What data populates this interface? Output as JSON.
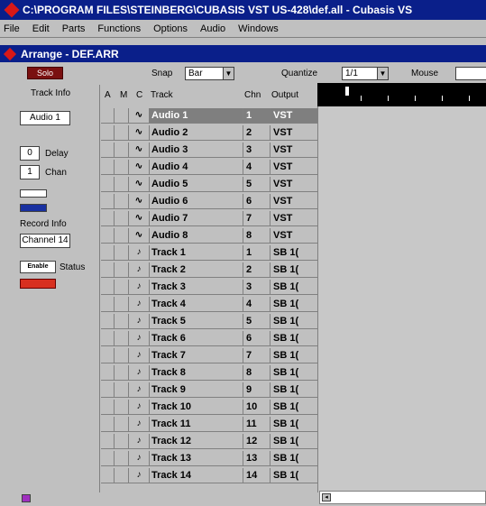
{
  "window": {
    "title": "C:\\PROGRAM FILES\\STEINBERG\\CUBASIS VST US-428\\def.all - Cubasis VS"
  },
  "menubar": {
    "items": [
      {
        "label": "File"
      },
      {
        "label": "Edit"
      },
      {
        "label": "Parts"
      },
      {
        "label": "Functions"
      },
      {
        "label": "Options"
      },
      {
        "label": "Audio"
      },
      {
        "label": "Windows"
      }
    ]
  },
  "arrange": {
    "title": "Arrange - DEF.ARR"
  },
  "toolbar": {
    "solo_label": "Solo",
    "snap_label": "Snap",
    "snap_value": "Bar",
    "quantize_label": "Quantize",
    "quantize_value": "1/1",
    "mouse_label": "Mouse"
  },
  "track_info": {
    "heading": "Track Info",
    "track_name": "Audio 1",
    "delay_value": "0",
    "delay_label": "Delay",
    "chan_value": "1",
    "chan_label": "Chan",
    "record_info_label": "Record Info",
    "record_channel": "Channel 14",
    "enable_label": "Enable",
    "status_label": "Status"
  },
  "track_table": {
    "headers": {
      "a": "A",
      "m": "M",
      "c": "C",
      "track": "Track",
      "chn": "Chn",
      "output": "Output"
    },
    "rows": [
      {
        "c": "∿",
        "track": "Audio 1",
        "chn": "1",
        "output": "VST",
        "selected": true
      },
      {
        "c": "∿",
        "track": "Audio 2",
        "chn": "2",
        "output": "VST"
      },
      {
        "c": "∿",
        "track": "Audio 3",
        "chn": "3",
        "output": "VST"
      },
      {
        "c": "∿",
        "track": "Audio 4",
        "chn": "4",
        "output": "VST"
      },
      {
        "c": "∿",
        "track": "Audio 5",
        "chn": "5",
        "output": "VST"
      },
      {
        "c": "∿",
        "track": "Audio 6",
        "chn": "6",
        "output": "VST"
      },
      {
        "c": "∿",
        "track": "Audio 7",
        "chn": "7",
        "output": "VST"
      },
      {
        "c": "∿",
        "track": "Audio 8",
        "chn": "8",
        "output": "VST"
      },
      {
        "c": "♪",
        "track": "Track 1",
        "chn": "1",
        "output": "SB 1("
      },
      {
        "c": "♪",
        "track": "Track 2",
        "chn": "2",
        "output": "SB 1("
      },
      {
        "c": "♪",
        "track": "Track 3",
        "chn": "3",
        "output": "SB 1("
      },
      {
        "c": "♪",
        "track": "Track 4",
        "chn": "4",
        "output": "SB 1("
      },
      {
        "c": "♪",
        "track": "Track 5",
        "chn": "5",
        "output": "SB 1("
      },
      {
        "c": "♪",
        "track": "Track 6",
        "chn": "6",
        "output": "SB 1("
      },
      {
        "c": "♪",
        "track": "Track 7",
        "chn": "7",
        "output": "SB 1("
      },
      {
        "c": "♪",
        "track": "Track 8",
        "chn": "8",
        "output": "SB 1("
      },
      {
        "c": "♪",
        "track": "Track 9",
        "chn": "9",
        "output": "SB 1("
      },
      {
        "c": "♪",
        "track": "Track 10",
        "chn": "10",
        "output": "SB 1("
      },
      {
        "c": "♪",
        "track": "Track 11",
        "chn": "11",
        "output": "SB 1("
      },
      {
        "c": "♪",
        "track": "Track 12",
        "chn": "12",
        "output": "SB 1("
      },
      {
        "c": "♪",
        "track": "Track 13",
        "chn": "13",
        "output": "SB 1("
      },
      {
        "c": "♪",
        "track": "Track 14",
        "chn": "14",
        "output": "SB 1("
      }
    ]
  }
}
